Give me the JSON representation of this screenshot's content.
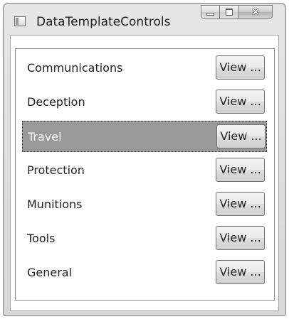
{
  "window": {
    "title": "DataTemplateControls",
    "icon": "application-window-icon",
    "caption_buttons": [
      {
        "name": "minimize",
        "icon": "minimize-icon"
      },
      {
        "name": "maximize",
        "icon": "maximize-icon"
      },
      {
        "name": "close",
        "icon": "close-icon",
        "glyph": "✕"
      }
    ]
  },
  "list": {
    "selected_index": 2,
    "items": [
      {
        "label": "Communications",
        "button_label": "View ..."
      },
      {
        "label": "Deception",
        "button_label": "View ..."
      },
      {
        "label": "Travel",
        "button_label": "View ..."
      },
      {
        "label": "Protection",
        "button_label": "View ..."
      },
      {
        "label": "Munitions",
        "button_label": "View ..."
      },
      {
        "label": "Tools",
        "button_label": "View ..."
      },
      {
        "label": "General",
        "button_label": "View ..."
      }
    ]
  },
  "colors": {
    "selection_background": "#999999",
    "selection_text": "#ffffff",
    "text": "#222222"
  }
}
